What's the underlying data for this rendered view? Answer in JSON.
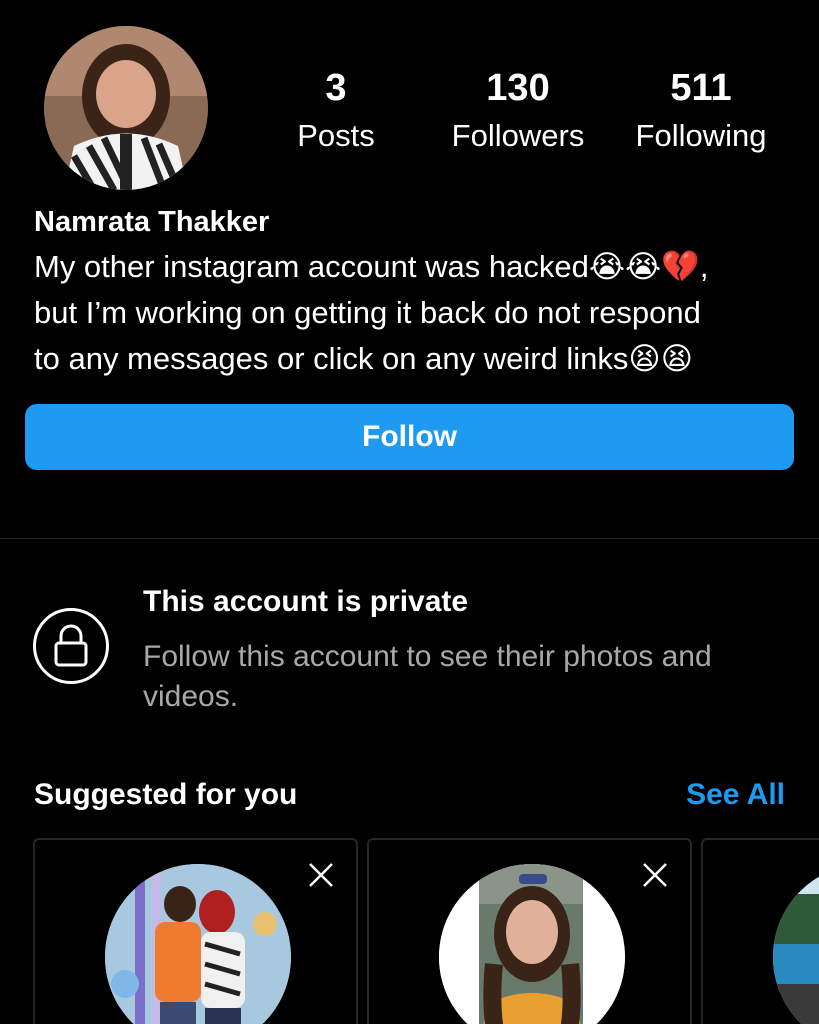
{
  "profile": {
    "avatar_icon": "profile-photo",
    "stats": [
      {
        "value": "3",
        "label": "Posts"
      },
      {
        "value": "130",
        "label": "Followers"
      },
      {
        "value": "511",
        "label": "Following"
      }
    ],
    "name": "Namrata Thakker",
    "bio_lines": [
      "My other instagram account was hacked😭😭💔,",
      "but I’m working on getting it back do not respond",
      "to any messages or click on any weird links😫😫"
    ],
    "follow_label": "Follow"
  },
  "private_notice": {
    "icon": "lock-icon",
    "title": "This account is private",
    "description": "Follow this account to see their photos and videos."
  },
  "suggested": {
    "title": "Suggested for you",
    "see_all": "See All",
    "cards": [
      {
        "avatar_icon": "couple-photo",
        "dismiss_icon": "close-icon"
      },
      {
        "avatar_icon": "woman-photo",
        "dismiss_icon": "close-icon"
      },
      {
        "avatar_icon": "pool-photo"
      }
    ]
  },
  "colors": {
    "background": "#000000",
    "accent": "#1e9bf0",
    "muted_text": "#a8a8a8",
    "divider": "#262626"
  }
}
